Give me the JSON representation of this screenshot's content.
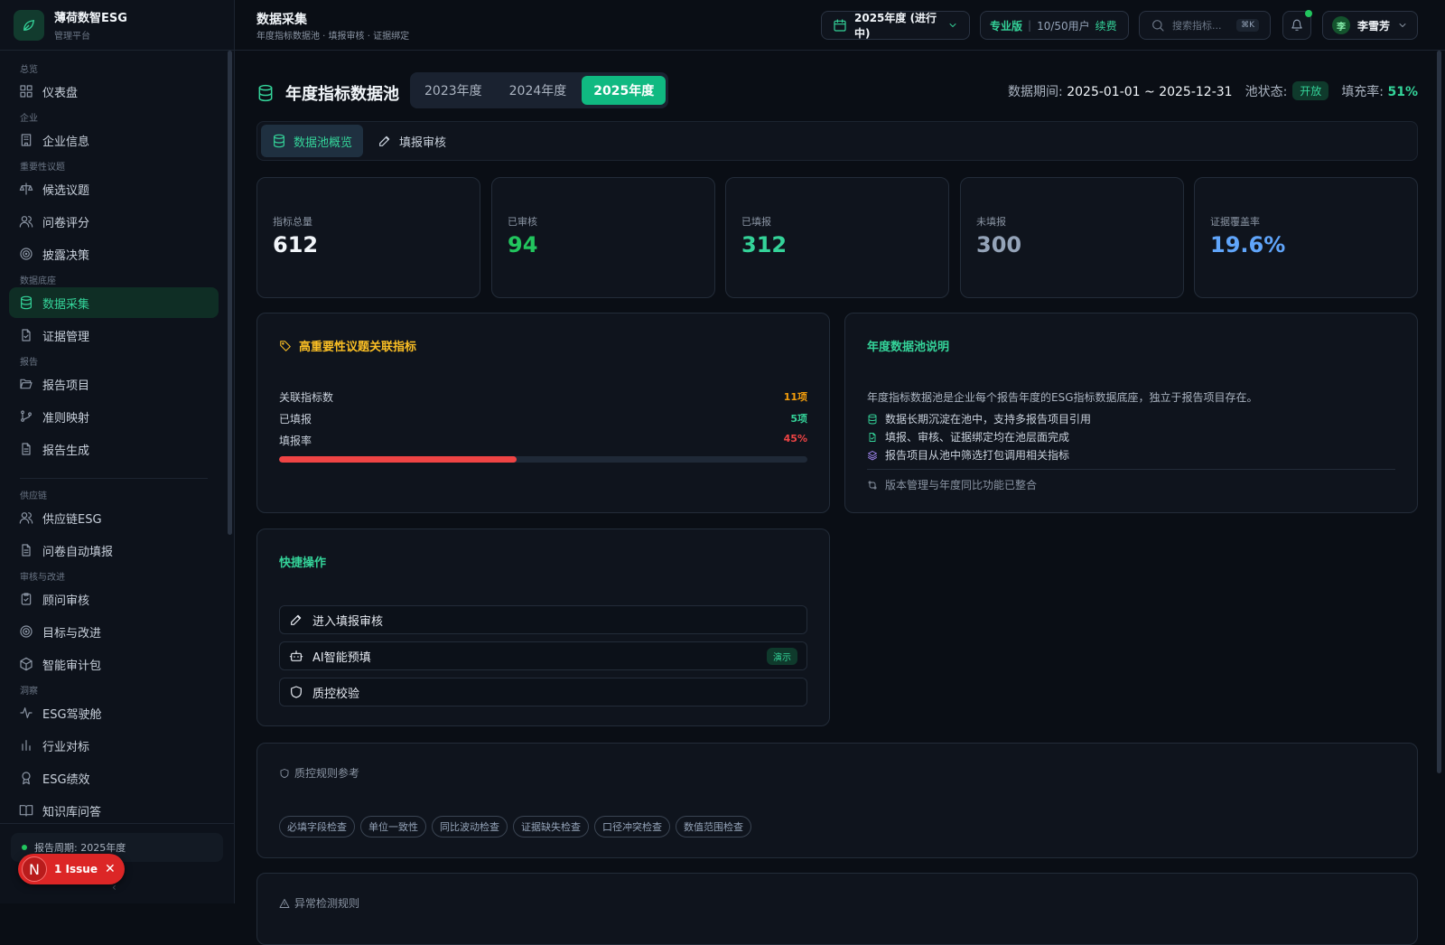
{
  "brand": {
    "title": "薄荷数智ESG",
    "subtitle": "管理平台"
  },
  "nav": {
    "sections": {
      "overview": "总览",
      "enterprise": "企业",
      "materiality": "重要性议题",
      "data": "数据底座",
      "report": "报告",
      "supply": "供应链",
      "audit": "审核与改进",
      "insight": "洞察"
    },
    "items": [
      "仪表盘",
      "企业信息",
      "候选议题",
      "问卷评分",
      "披露决策",
      "数据采集",
      "证据管理",
      "报告项目",
      "准则映射",
      "报告生成",
      "供应链ESG",
      "问卷自动填报",
      "顾问审核",
      "目标与改进",
      "智能审计包",
      "ESG驾驶舱",
      "行业对标",
      "ESG绩效",
      "知识库问答"
    ],
    "period": "报告周期: 2025年度",
    "issue": {
      "letter": "N",
      "label": "1 Issue"
    }
  },
  "header": {
    "title": "数据采集",
    "subtitle": "年度指标数据池 · 填报审核 · 证据绑定",
    "year_select": "2025年度 (进行中)",
    "plan": {
      "name": "专业版",
      "users": "10/50用户",
      "renew": "续费"
    },
    "search_placeholder": "搜索指标...",
    "shortcut": "⌘K",
    "user": {
      "initial": "李",
      "name": "李雪芳"
    }
  },
  "pool": {
    "title": "年度指标数据池",
    "years": [
      "2023年度",
      "2024年度",
      "2025年度"
    ],
    "active_year": "2025年度",
    "period_label": "数据期间:",
    "period": "2025-01-01 ~ 2025-12-31",
    "status_label": "池状态:",
    "status": "开放",
    "fill_label": "填充率:",
    "fill": "51%"
  },
  "tabs": [
    "数据池概览",
    "填报审核"
  ],
  "stats": [
    {
      "label": "指标总量",
      "value": "612",
      "color": "#f1f5f9"
    },
    {
      "label": "已审核",
      "value": "94",
      "color": "#22c55e"
    },
    {
      "label": "已填报",
      "value": "312",
      "color": "#34d399"
    },
    {
      "label": "未填报",
      "value": "300",
      "color": "#94a3b8"
    },
    {
      "label": "证据覆盖率",
      "value": "19.6%",
      "color": "#60a5fa"
    }
  ],
  "high_material": {
    "title": "高重要性议题关联指标",
    "rows": [
      {
        "label": "关联指标数",
        "value": "11项",
        "color": "#f59e0b"
      },
      {
        "label": "已填报",
        "value": "5项",
        "color": "#34d399"
      },
      {
        "label": "填报率",
        "value": "45%",
        "color": "#ef4444"
      }
    ],
    "progress": 0.45
  },
  "pool_info": {
    "title": "年度数据池说明",
    "desc": "年度指标数据池是企业每个报告年度的ESG指标数据底座，独立于报告项目存在。",
    "bullets": [
      "数据长期沉淀在池中，支持多报告项目引用",
      "填报、审核、证据绑定均在池层面完成",
      "报告项目从池中筛选打包调用相关指标"
    ],
    "footer": "版本管理与年度同比功能已整合"
  },
  "quick": {
    "title": "快捷操作",
    "actions": [
      "进入填报审核",
      "AI智能预填",
      "质控校验"
    ],
    "demo": "演示"
  },
  "qc": {
    "title": "质控规则参考",
    "chips": [
      "必填字段检查",
      "单位一致性",
      "同比波动检查",
      "证据缺失检查",
      "口径冲突检查",
      "数值范围检查"
    ]
  },
  "anomaly": {
    "title": "异常检测规则"
  },
  "colors": {
    "accent": "#34d399",
    "warn": "#f59e0b",
    "danger": "#ef4444"
  }
}
